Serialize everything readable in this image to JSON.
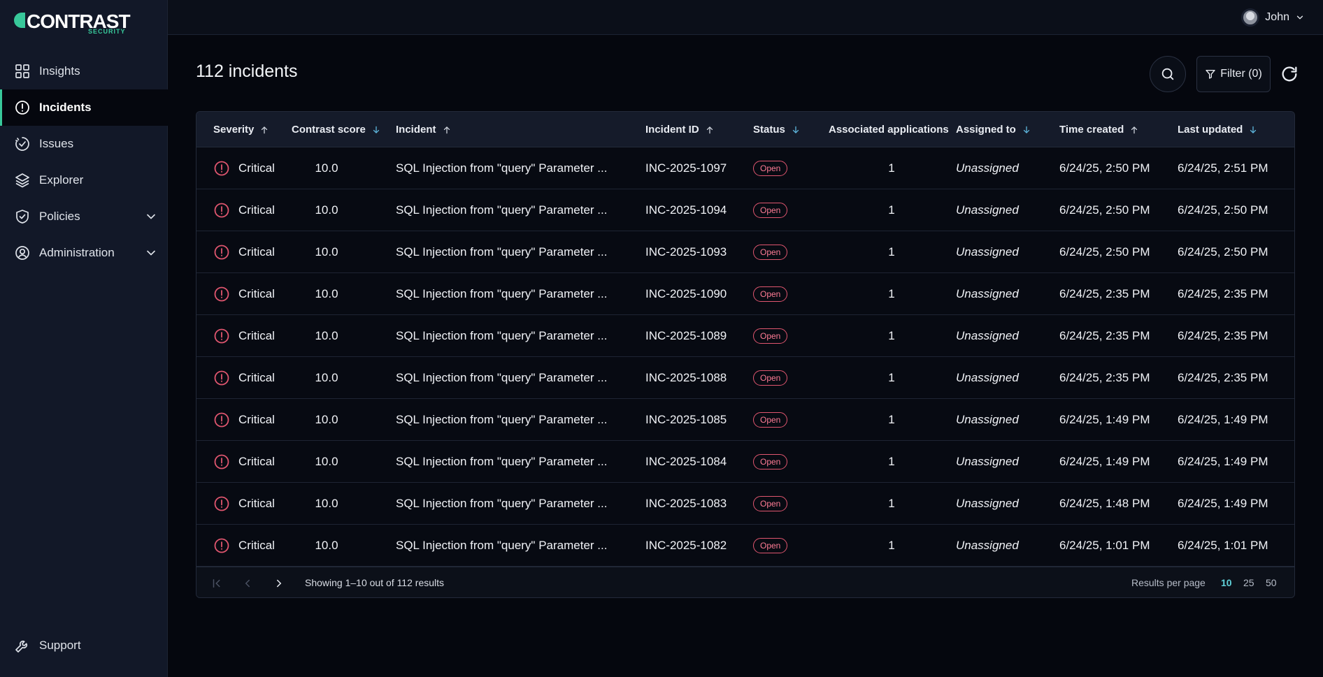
{
  "brand": {
    "logo_text": "CONTRAST",
    "logo_sub": "SECURITY",
    "accent": "#38c89a"
  },
  "sidebar": {
    "items": [
      {
        "label": "Insights",
        "icon": "grid-icon",
        "active": false,
        "expandable": false
      },
      {
        "label": "Incidents",
        "icon": "alert-circle-icon",
        "active": true,
        "expandable": false
      },
      {
        "label": "Issues",
        "icon": "bug-progress-icon",
        "active": false,
        "expandable": false
      },
      {
        "label": "Explorer",
        "icon": "layers-icon",
        "active": false,
        "expandable": false
      },
      {
        "label": "Policies",
        "icon": "shield-check-icon",
        "active": false,
        "expandable": true
      },
      {
        "label": "Administration",
        "icon": "user-circle-icon",
        "active": false,
        "expandable": true
      }
    ],
    "support_label": "Support"
  },
  "topbar": {
    "user_name": "John"
  },
  "main": {
    "title": "112 incidents",
    "filter_label": "Filter (0)"
  },
  "table": {
    "columns": [
      {
        "label": "Severity",
        "sort": "up"
      },
      {
        "label": "Contrast score",
        "sort": "down"
      },
      {
        "label": "Incident",
        "sort": "up"
      },
      {
        "label": "Incident ID",
        "sort": "up"
      },
      {
        "label": "Status",
        "sort": "down"
      },
      {
        "label": "Associated applications",
        "sort": "none"
      },
      {
        "label": "Assigned to",
        "sort": "down"
      },
      {
        "label": "Time created",
        "sort": "up"
      },
      {
        "label": "Last updated",
        "sort": "down"
      }
    ],
    "rows": [
      {
        "severity": "Critical",
        "score": "10.0",
        "incident": "SQL Injection from \"query\" Parameter ...",
        "id": "INC-2025-1097",
        "status": "Open",
        "apps": "1",
        "assigned": "Unassigned",
        "created": "6/24/25, 2:50 PM",
        "updated": "6/24/25, 2:51 PM"
      },
      {
        "severity": "Critical",
        "score": "10.0",
        "incident": "SQL Injection from \"query\" Parameter ...",
        "id": "INC-2025-1094",
        "status": "Open",
        "apps": "1",
        "assigned": "Unassigned",
        "created": "6/24/25, 2:50 PM",
        "updated": "6/24/25, 2:50 PM"
      },
      {
        "severity": "Critical",
        "score": "10.0",
        "incident": "SQL Injection from \"query\" Parameter ...",
        "id": "INC-2025-1093",
        "status": "Open",
        "apps": "1",
        "assigned": "Unassigned",
        "created": "6/24/25, 2:50 PM",
        "updated": "6/24/25, 2:50 PM"
      },
      {
        "severity": "Critical",
        "score": "10.0",
        "incident": "SQL Injection from \"query\" Parameter ...",
        "id": "INC-2025-1090",
        "status": "Open",
        "apps": "1",
        "assigned": "Unassigned",
        "created": "6/24/25, 2:35 PM",
        "updated": "6/24/25, 2:35 PM"
      },
      {
        "severity": "Critical",
        "score": "10.0",
        "incident": "SQL Injection from \"query\" Parameter ...",
        "id": "INC-2025-1089",
        "status": "Open",
        "apps": "1",
        "assigned": "Unassigned",
        "created": "6/24/25, 2:35 PM",
        "updated": "6/24/25, 2:35 PM"
      },
      {
        "severity": "Critical",
        "score": "10.0",
        "incident": "SQL Injection from \"query\" Parameter ...",
        "id": "INC-2025-1088",
        "status": "Open",
        "apps": "1",
        "assigned": "Unassigned",
        "created": "6/24/25, 2:35 PM",
        "updated": "6/24/25, 2:35 PM"
      },
      {
        "severity": "Critical",
        "score": "10.0",
        "incident": "SQL Injection from \"query\" Parameter ...",
        "id": "INC-2025-1085",
        "status": "Open",
        "apps": "1",
        "assigned": "Unassigned",
        "created": "6/24/25, 1:49 PM",
        "updated": "6/24/25, 1:49 PM"
      },
      {
        "severity": "Critical",
        "score": "10.0",
        "incident": "SQL Injection from \"query\" Parameter ...",
        "id": "INC-2025-1084",
        "status": "Open",
        "apps": "1",
        "assigned": "Unassigned",
        "created": "6/24/25, 1:49 PM",
        "updated": "6/24/25, 1:49 PM"
      },
      {
        "severity": "Critical",
        "score": "10.0",
        "incident": "SQL Injection from \"query\" Parameter ...",
        "id": "INC-2025-1083",
        "status": "Open",
        "apps": "1",
        "assigned": "Unassigned",
        "created": "6/24/25, 1:48 PM",
        "updated": "6/24/25, 1:49 PM"
      },
      {
        "severity": "Critical",
        "score": "10.0",
        "incident": "SQL Injection from \"query\" Parameter ...",
        "id": "INC-2025-1082",
        "status": "Open",
        "apps": "1",
        "assigned": "Unassigned",
        "created": "6/24/25, 1:01 PM",
        "updated": "6/24/25, 1:01 PM"
      }
    ],
    "footer": {
      "showing_prefix": "Showing ",
      "showing_range": "1–10",
      "showing_mid": " out of ",
      "showing_total": "112",
      "showing_suffix": " results",
      "rpp_label": "Results per page",
      "rpp_options": [
        "10",
        "25",
        "50"
      ],
      "rpp_selected": "10"
    }
  },
  "colors": {
    "critical": "#e0566f",
    "rpp_selected": "#5fd0d8"
  }
}
